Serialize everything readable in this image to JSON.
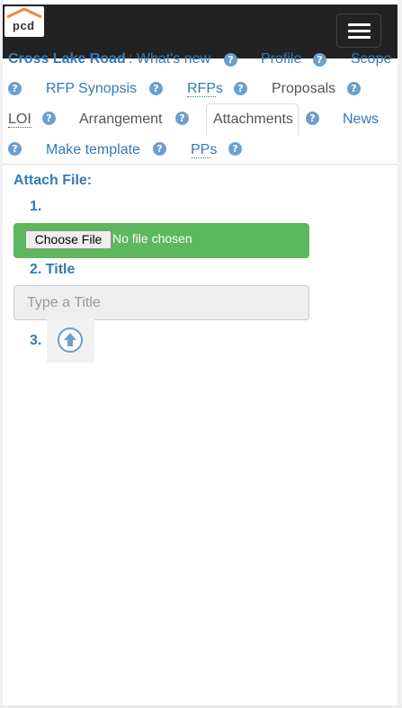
{
  "brand": {
    "logo_text": "pcd",
    "accent": "#f0883e"
  },
  "colors": {
    "link": "#337ab7",
    "success": "#5cb85c",
    "navbar": "#222222",
    "help": "#6a9fcf"
  },
  "nav": {
    "project_name": "Cross Lake Road",
    "whats_new": ": What's new",
    "profile": "Profile",
    "scope": "Scope",
    "rfp_synopsis": "RFP Synopsis",
    "rfp_abbr": "RFP",
    "rfp_suffix": "s",
    "proposals": "Proposals",
    "loi": "LOI",
    "arrangement": "Arrangement",
    "attachments": "Attachments",
    "news": "News",
    "make_template": "Make template",
    "pp_abbr": "PP",
    "pp_suffix": "s",
    "help_glyph": "?"
  },
  "form": {
    "heading": "Attach File:",
    "step1": "1.",
    "file_button": "Choose File",
    "file_status": "No file chosen",
    "step2": "2. Title",
    "title_placeholder": "Type a Title",
    "step3": "3."
  }
}
